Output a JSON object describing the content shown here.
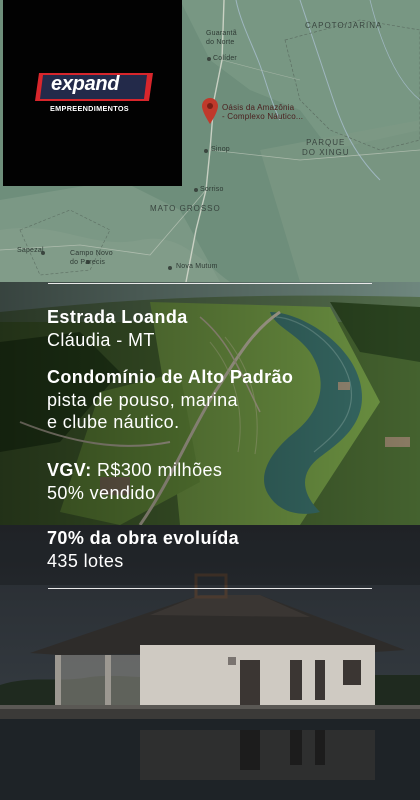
{
  "brand": {
    "name": "expand",
    "subtitle": "EMPREENDIMENTOS",
    "colors": {
      "accent": "#d8262c",
      "badge": "#232a4a",
      "background": "#020202"
    }
  },
  "map": {
    "labels": {
      "capoto": "CAPOTO/JARINA",
      "guaranta": "Guarantã\ndo Norte",
      "colider": "Colíder",
      "poi": "Oásis da Amazônia\n- Complexo Náutico...",
      "sinop": "Sinop",
      "parque": "PARQUE\nDO XINGU",
      "sorriso": "Sorriso",
      "state": "MATO GROSSO",
      "sapezal": "Sapezal",
      "campo": "Campo Novo\ndo Parecis",
      "mutum": "Nova Mutum"
    },
    "pin_icon": "map-pin-icon"
  },
  "project": {
    "road": "Estrada Loanda",
    "city": "Cláudia - MT",
    "headline": "Condomínio de Alto Padrão",
    "feature_line1": "pista de pouso, marina",
    "feature_line2": "e clube náutico.",
    "vgv_label": "VGV:",
    "vgv_value": " R$300 milhões",
    "sold": "50% vendido",
    "progress": "70% da obra evoluída",
    "lots": "435 lotes"
  }
}
